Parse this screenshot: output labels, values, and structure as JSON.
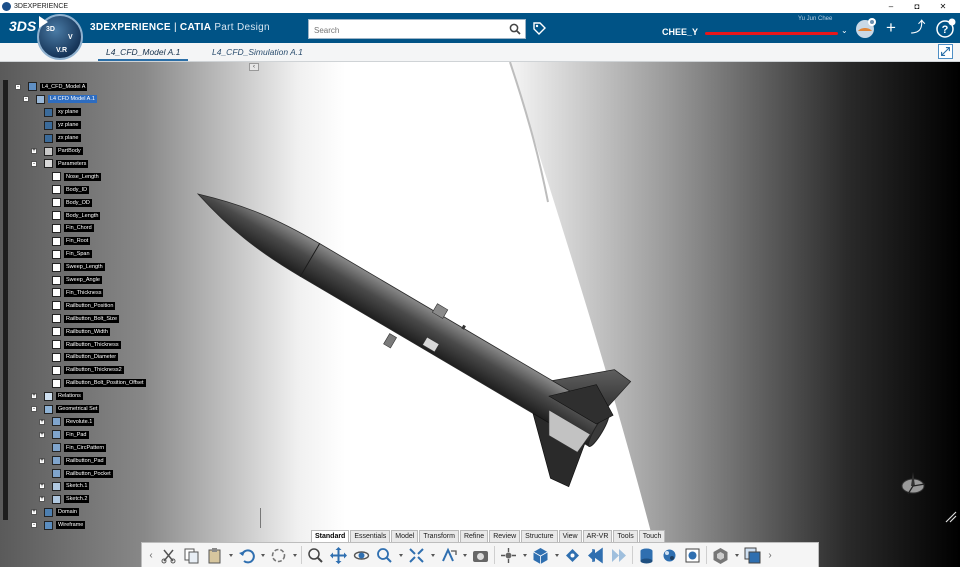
{
  "os": {
    "app_label": "3DEXPERIENCE",
    "controls": [
      "–",
      "◘",
      "✕"
    ]
  },
  "header": {
    "logo": "3DS",
    "compass_labels": {
      "top": "3D",
      "left": "V",
      "bottom": "V.R"
    },
    "app_title_brand": "3DEXPERIENCE",
    "app_title_sep": " | ",
    "app_title_product": "CATIA",
    "app_title_app": "Part Design",
    "search_placeholder": "Search",
    "username": "CHEE_Y",
    "user_subtitle": "Yu Jun Chee",
    "user_menu_icon": "chevron-down",
    "icons": [
      "tag-icon",
      "avatar",
      "plus-icon",
      "share-icon",
      "help-icon"
    ],
    "plus": "+",
    "share": "⤴",
    "help": "?"
  },
  "tabs": {
    "items": [
      {
        "label": "L4_CFD_Model A.1",
        "active": true
      },
      {
        "label": "L4_CFD_Simulation A.1",
        "active": false
      }
    ]
  },
  "tree": {
    "collapse_glyph": "‹",
    "nodes": [
      {
        "label": "L4_CFD_Model A",
        "icon": "product-icon",
        "expander": "-",
        "selected": false
      },
      {
        "label": "L4 CFD Model A.1",
        "icon": "part-icon",
        "expander": "-",
        "selected": true
      },
      {
        "label": "xy plane",
        "icon": "plane-icon",
        "expander": "",
        "selected": false
      },
      {
        "label": "yz plane",
        "icon": "plane-icon",
        "expander": "",
        "selected": false
      },
      {
        "label": "zx plane",
        "icon": "plane-icon",
        "expander": "",
        "selected": false
      },
      {
        "label": "PartBody",
        "icon": "body-icon",
        "expander": "+",
        "selected": false
      },
      {
        "label": "Parameters",
        "icon": "parameters-icon",
        "expander": "-",
        "selected": false
      },
      {
        "label": "Nose_Length",
        "icon": "parameter-icon",
        "expander": "",
        "selected": false
      },
      {
        "label": "Body_ID",
        "icon": "parameter-icon",
        "expander": "",
        "selected": false
      },
      {
        "label": "Body_OD",
        "icon": "parameter-icon",
        "expander": "",
        "selected": false
      },
      {
        "label": "Body_Length",
        "icon": "parameter-icon",
        "expander": "",
        "selected": false
      },
      {
        "label": "Fin_Chord",
        "icon": "parameter-icon",
        "expander": "",
        "selected": false
      },
      {
        "label": "Fin_Root",
        "icon": "parameter-icon",
        "expander": "",
        "selected": false
      },
      {
        "label": "Fin_Span",
        "icon": "parameter-icon",
        "expander": "",
        "selected": false
      },
      {
        "label": "Sweep_Length",
        "icon": "parameter-icon",
        "expander": "",
        "selected": false
      },
      {
        "label": "Sweep_Angle",
        "icon": "parameter-icon",
        "expander": "",
        "selected": false
      },
      {
        "label": "Fin_Thickness",
        "icon": "parameter-icon",
        "expander": "",
        "selected": false
      },
      {
        "label": "Railbutton_Position",
        "icon": "parameter-icon",
        "expander": "",
        "selected": false
      },
      {
        "label": "Railbutton_Bolt_Size",
        "icon": "parameter-icon",
        "expander": "",
        "selected": false
      },
      {
        "label": "Railbutton_Width",
        "icon": "parameter-icon",
        "expander": "",
        "selected": false
      },
      {
        "label": "Railbutton_Thickness",
        "icon": "parameter-icon",
        "expander": "",
        "selected": false
      },
      {
        "label": "Railbutton_Diameter",
        "icon": "parameter-icon",
        "expander": "",
        "selected": false
      },
      {
        "label": "Railbutton_Thickness2",
        "icon": "parameter-icon",
        "expander": "",
        "selected": false
      },
      {
        "label": "Railbutton_Bolt_Position_Offset",
        "icon": "parameter-icon",
        "expander": "",
        "selected": false
      },
      {
        "label": "Relations",
        "icon": "relations-icon",
        "expander": "+",
        "selected": false
      },
      {
        "label": "Geometrical Set",
        "icon": "geoset-icon",
        "expander": "-",
        "selected": false
      },
      {
        "label": "Revolute.1",
        "icon": "feature-icon",
        "expander": "+",
        "selected": false
      },
      {
        "label": "Fin_Pad",
        "icon": "feature-icon",
        "expander": "+",
        "selected": false
      },
      {
        "label": "Fin_CircPattern",
        "icon": "feature-icon",
        "expander": "",
        "selected": false
      },
      {
        "label": "Railbutton_Pad",
        "icon": "feature-icon",
        "expander": "+",
        "selected": false
      },
      {
        "label": "Railbutton_Pocket",
        "icon": "feature-icon",
        "expander": "",
        "selected": false
      },
      {
        "label": "Sketch.1",
        "icon": "sketch-icon",
        "expander": "+",
        "selected": false
      },
      {
        "label": "Sketch.2",
        "icon": "sketch-icon",
        "expander": "+",
        "selected": false
      },
      {
        "label": "Domain",
        "icon": "domain-icon",
        "expander": "+",
        "selected": false
      },
      {
        "label": "Wireframe",
        "icon": "wireframe-icon",
        "expander": "-",
        "selected": false
      }
    ]
  },
  "section_tabs": [
    {
      "label": "Standard",
      "active": true
    },
    {
      "label": "Essentials",
      "active": false
    },
    {
      "label": "Model",
      "active": false
    },
    {
      "label": "Transform",
      "active": false
    },
    {
      "label": "Refine",
      "active": false
    },
    {
      "label": "Review",
      "active": false
    },
    {
      "label": "Structure",
      "active": false
    },
    {
      "label": "View",
      "active": false
    },
    {
      "label": "AR-VR",
      "active": false
    },
    {
      "label": "Tools",
      "active": false
    },
    {
      "label": "Touch",
      "active": false
    }
  ],
  "action_bar": {
    "scroll_left": "‹",
    "commands": [
      "cut-icon",
      "copy-icon",
      "paste-icon",
      "undo-icon",
      "update-icon",
      "zoom-in-icon",
      "pan-icon",
      "rotate-icon",
      "zoom-icon",
      "fit-all-icon",
      "normal-view-icon",
      "capture-icon",
      "explode-icon",
      "view-cube-icon",
      "fly-icon",
      "previous-view-icon",
      "next-view-icon",
      "render-icon",
      "material-icon",
      "quick-render-icon",
      "display-mode-icon",
      "layer-icon"
    ],
    "scroll_right": "›"
  },
  "colors": {
    "header_bg": "#005386",
    "tab_active_underline": "#2b6fa8",
    "tree_selected": "#2d6cc0",
    "icon_blue": "#2f6fb0",
    "redaction": "#e8171b"
  }
}
